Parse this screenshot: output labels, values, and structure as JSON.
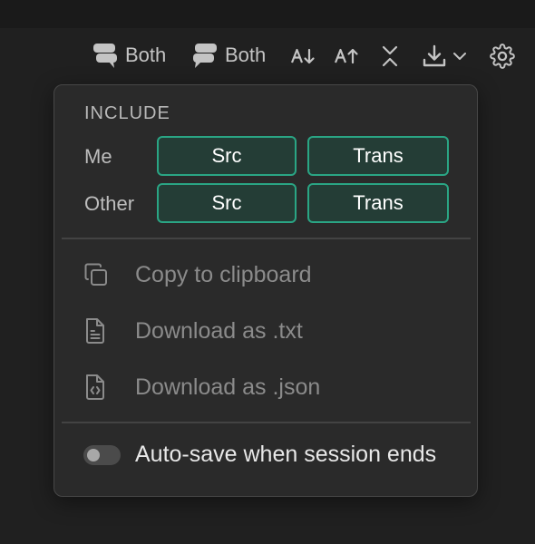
{
  "toolbar": {
    "speaker_me_label": "Both",
    "speaker_other_label": "Both",
    "icons": [
      "speech-bubbles-icon",
      "speech-bubbles-reversed-icon",
      "sort-descending-icon",
      "sort-ascending-icon",
      "collapse-icon",
      "download-icon",
      "chevron-down-icon",
      "gear-icon"
    ]
  },
  "popover": {
    "section_title": "INCLUDE",
    "rows": [
      {
        "label": "Me",
        "src": "Src",
        "trans": "Trans"
      },
      {
        "label": "Other",
        "src": "Src",
        "trans": "Trans"
      }
    ],
    "actions": [
      {
        "label": "Copy to clipboard",
        "icon": "copy-icon"
      },
      {
        "label": "Download as .txt",
        "icon": "file-text-icon"
      },
      {
        "label": "Download as .json",
        "icon": "file-code-icon"
      }
    ],
    "autosave": {
      "label": "Auto-save when session ends",
      "enabled": false
    }
  },
  "colors": {
    "background": "#202020",
    "popover": "#2a2a2a",
    "accent": "#2aa584",
    "pill_fill": "#243d36"
  }
}
